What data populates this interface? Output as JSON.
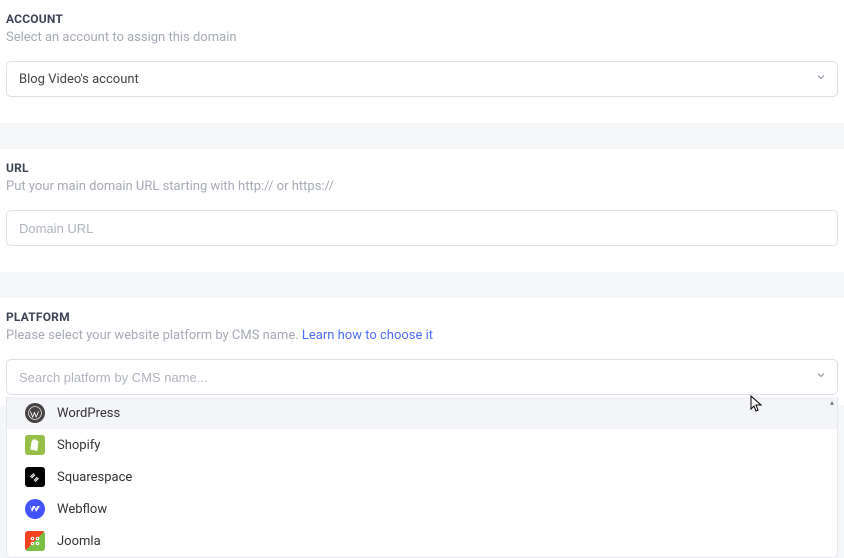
{
  "account": {
    "heading": "ACCOUNT",
    "subtext": "Select an account to assign this domain",
    "selected": "Blog Video's account"
  },
  "url": {
    "heading": "URL",
    "subtext": "Put your main domain URL starting with http:// or https://",
    "placeholder": "Domain URL",
    "value": ""
  },
  "platform": {
    "heading": "PLATFORM",
    "subtext_prefix": "Please select your website platform by CMS name. ",
    "learn_link": "Learn how to choose it",
    "search_placeholder": "Search platform by CMS name...",
    "search_value": "",
    "options": [
      {
        "id": "wordpress",
        "label": "WordPress",
        "icon": "wordpress-icon",
        "highlighted": true
      },
      {
        "id": "shopify",
        "label": "Shopify",
        "icon": "shopify-icon",
        "highlighted": false
      },
      {
        "id": "squarespace",
        "label": "Squarespace",
        "icon": "squarespace-icon",
        "highlighted": false
      },
      {
        "id": "webflow",
        "label": "Webflow",
        "icon": "webflow-icon",
        "highlighted": false
      },
      {
        "id": "joomla",
        "label": "Joomla",
        "icon": "joomla-icon",
        "highlighted": false
      }
    ]
  }
}
